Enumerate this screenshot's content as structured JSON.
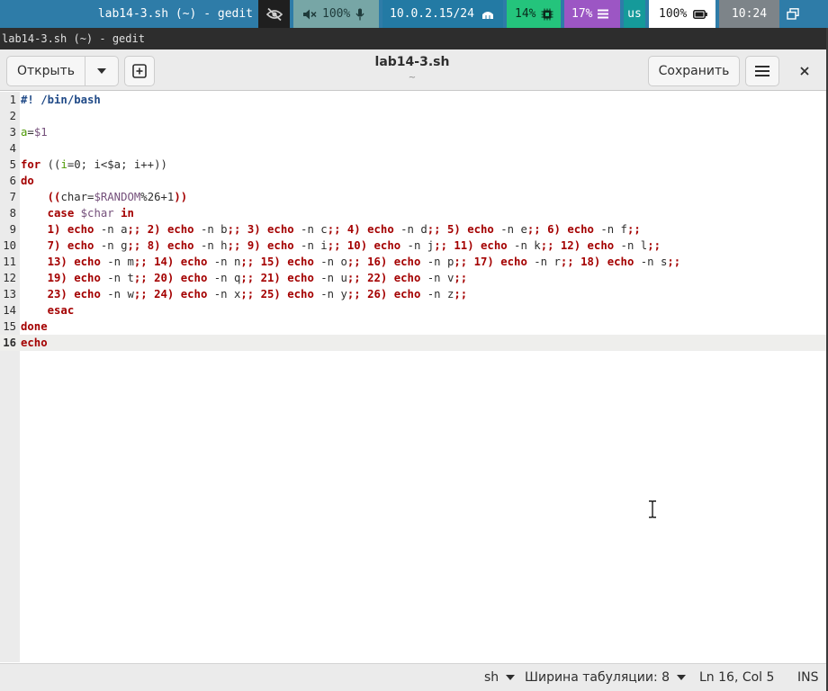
{
  "topbar": {
    "window_title": "lab14-3.sh (~) - gedit",
    "volume": "100%",
    "network": "10.0.2.15/24",
    "cpu": "14%",
    "memory": "17%",
    "keyboard_layout": "us",
    "battery": "100%",
    "clock": "10:24",
    "icons": [
      "eye-slash-icon",
      "speaker-muted-icon",
      "microphone-icon",
      "network-icon",
      "cpu-chip-icon",
      "list-icon",
      "battery-icon",
      "window-switch-icon"
    ]
  },
  "window": {
    "title": "lab14-3.sh (~) - gedit"
  },
  "header": {
    "open_label": "Открыть",
    "doc_title": "lab14-3.sh",
    "doc_subtitle": "~",
    "save_label": "Сохранить"
  },
  "editor": {
    "current_line": 16,
    "lines": [
      {
        "n": "1",
        "text": "#! /bin/bash"
      },
      {
        "n": "2",
        "text": ""
      },
      {
        "n": "3",
        "text": "a=$1"
      },
      {
        "n": "4",
        "text": ""
      },
      {
        "n": "5",
        "text": "for ((i=0; i<$a; i++))"
      },
      {
        "n": "6",
        "text": "do"
      },
      {
        "n": "7",
        "text": "    ((char=$RANDOM%26+1))"
      },
      {
        "n": "8",
        "text": "    case $char in"
      },
      {
        "n": "9",
        "text": "    1) echo -n a;; 2) echo -n b;; 3) echo -n c;; 4) echo -n d;; 5) echo -n e;; 6) echo -n f;;"
      },
      {
        "n": "10",
        "text": "    7) echo -n g;; 8) echo -n h;; 9) echo -n i;; 10) echo -n j;; 11) echo -n k;; 12) echo -n l;;"
      },
      {
        "n": "11",
        "text": "    13) echo -n m;; 14) echo -n n;; 15) echo -n o;; 16) echo -n p;; 17) echo -n r;; 18) echo -n s;;"
      },
      {
        "n": "12",
        "text": "    19) echo -n t;; 20) echo -n q;; 21) echo -n u;; 22) echo -n v;;"
      },
      {
        "n": "13",
        "text": "    23) echo -n w;; 24) echo -n x;; 25) echo -n y;; 26) echo -n z;;"
      },
      {
        "n": "14",
        "text": "    esac"
      },
      {
        "n": "15",
        "text": "done"
      },
      {
        "n": "16",
        "text": "echo"
      }
    ]
  },
  "statusbar": {
    "language": "sh",
    "tab_width": "Ширина табуляции: 8",
    "position": "Ln 16, Col 5",
    "mode": "INS"
  },
  "colors": {
    "keyword": "#a40000",
    "builtin": "#204a87",
    "variable": "#75507b",
    "number": "#4e9a06",
    "gutter": "#ebebeb",
    "topbar": "#2e7ca8"
  }
}
